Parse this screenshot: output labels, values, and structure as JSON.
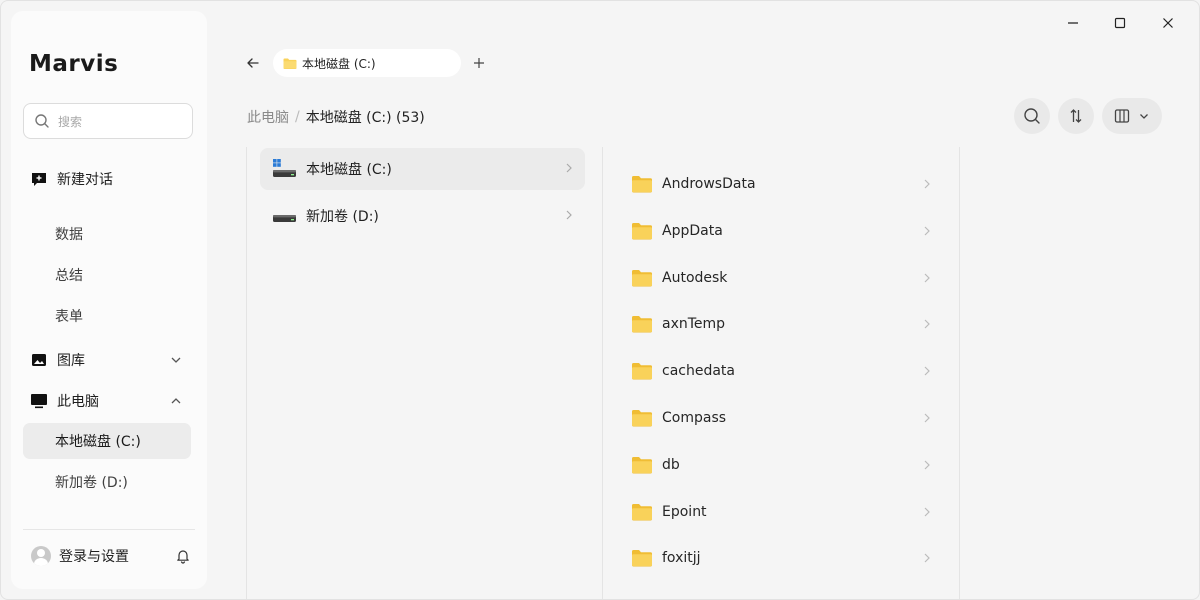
{
  "app": {
    "name": "Marvis"
  },
  "search": {
    "placeholder": "搜索"
  },
  "sidebar": {
    "new_chat": "新建对话",
    "items": [
      {
        "label": "数据"
      },
      {
        "label": "总结"
      },
      {
        "label": "表单"
      }
    ],
    "gallery": "图库",
    "this_pc": "此电脑",
    "drives": [
      {
        "label": "本地磁盘 (C:)",
        "active": true
      },
      {
        "label": "新加卷 (D:)",
        "active": false
      }
    ],
    "user": "登录与设置"
  },
  "tab": {
    "label": "本地磁盘 (C:)"
  },
  "breadcrumb": {
    "root": "此电脑",
    "current": "本地磁盘 (C:) (53)"
  },
  "drive_list": [
    {
      "label": "本地磁盘 (C:)",
      "icon": "windows-drive-icon"
    },
    {
      "label": "新加卷 (D:)",
      "icon": "drive-icon"
    }
  ],
  "folders": [
    {
      "name": "AndrowsData"
    },
    {
      "name": "AppData"
    },
    {
      "name": "Autodesk"
    },
    {
      "name": "axnTemp"
    },
    {
      "name": "cachedata"
    },
    {
      "name": "Compass"
    },
    {
      "name": "db"
    },
    {
      "name": "Epoint"
    },
    {
      "name": "foxitjj"
    }
  ],
  "colors": {
    "folder": "#f9d25a",
    "folder_dark": "#f0bd34",
    "accent": "#1a1a1a"
  }
}
